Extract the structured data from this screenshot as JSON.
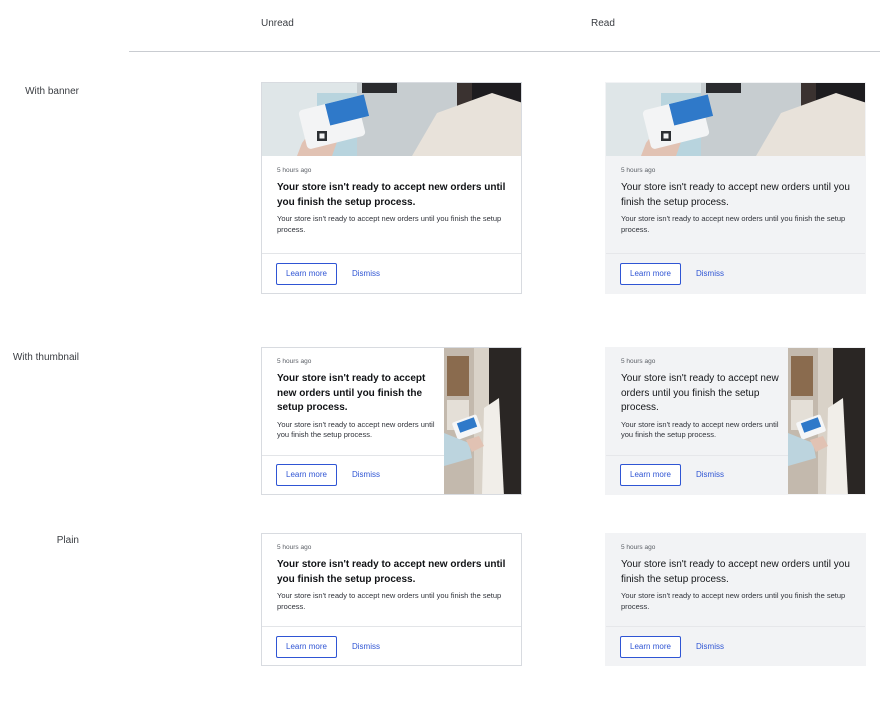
{
  "columns": {
    "unread": "Unread",
    "read": "Read"
  },
  "rows": {
    "banner": "With banner",
    "thumbnail": "With thumbnail",
    "plain": "Plain"
  },
  "notification": {
    "time": "5 hours ago",
    "title": "Your store isn't ready to accept new orders until you finish the setup process.",
    "body": "Your store isn't ready to accept new orders until you finish the setup process.",
    "learn_more": "Learn more",
    "dismiss": "Dismiss"
  },
  "colors": {
    "accent": "#2f55d4",
    "read_bg": "#f2f3f5",
    "border": "#d8dbe0"
  },
  "image_alt": "Card reader payment photo"
}
